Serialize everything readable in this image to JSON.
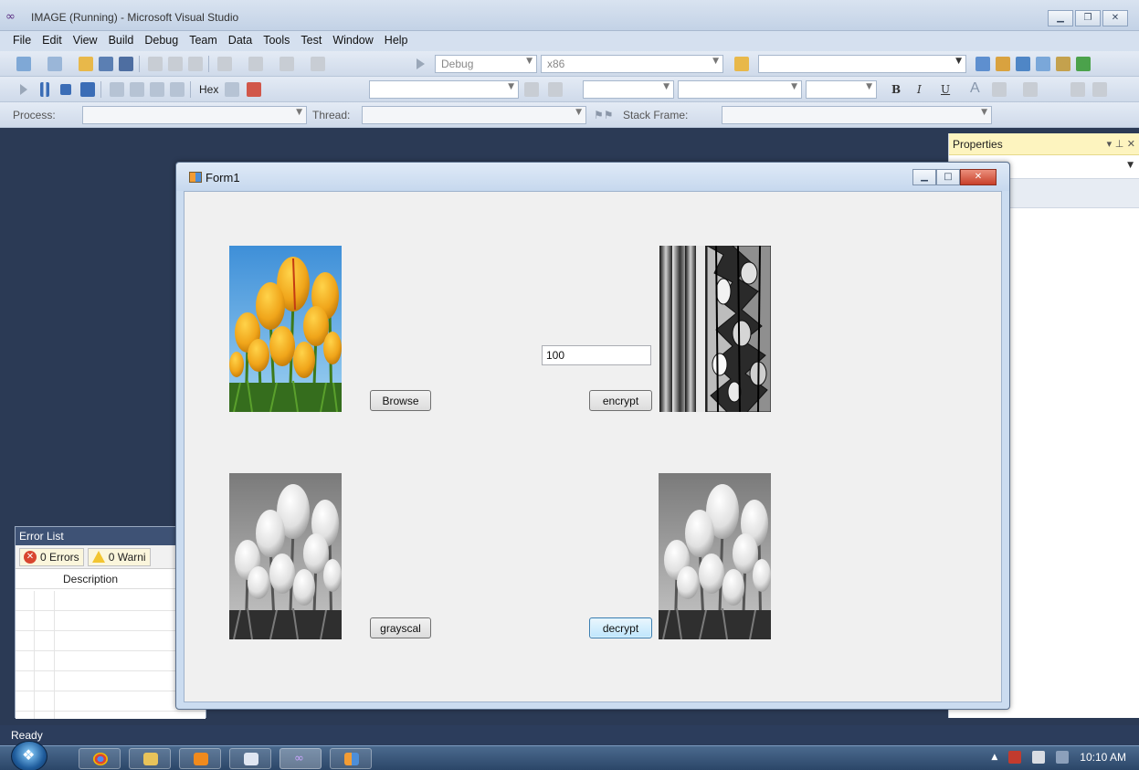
{
  "vs": {
    "title": "IMAGE (Running) - Microsoft Visual Studio",
    "menu": [
      "File",
      "Edit",
      "View",
      "Build",
      "Debug",
      "Team",
      "Data",
      "Tools",
      "Test",
      "Window",
      "Help"
    ],
    "toolbar": {
      "config": "Debug",
      "platform": "x86",
      "hex_label": "Hex",
      "process_label": "Process:",
      "thread_label": "Thread:",
      "stack_frame_label": "Stack Frame:"
    },
    "properties_title": "Properties",
    "error_list": {
      "title": "Error List",
      "errors_tab": "0 Errors",
      "warnings_tab": "0 Warni",
      "col_description": "Description"
    },
    "status": "Ready"
  },
  "form": {
    "title": "Form1",
    "browse_label": "Browse",
    "encrypt_label": "encrypt",
    "grayscale_label": "grayscal",
    "decrypt_label": "decrypt",
    "key_value": "100"
  },
  "taskbar": {
    "clock": "10:10 AM"
  },
  "colors": {
    "vs_background": "#2b3a55",
    "properties_header": "#fdf4bf",
    "taskbar": "#2b4668",
    "button_focus_border": "#3c7fb1"
  }
}
